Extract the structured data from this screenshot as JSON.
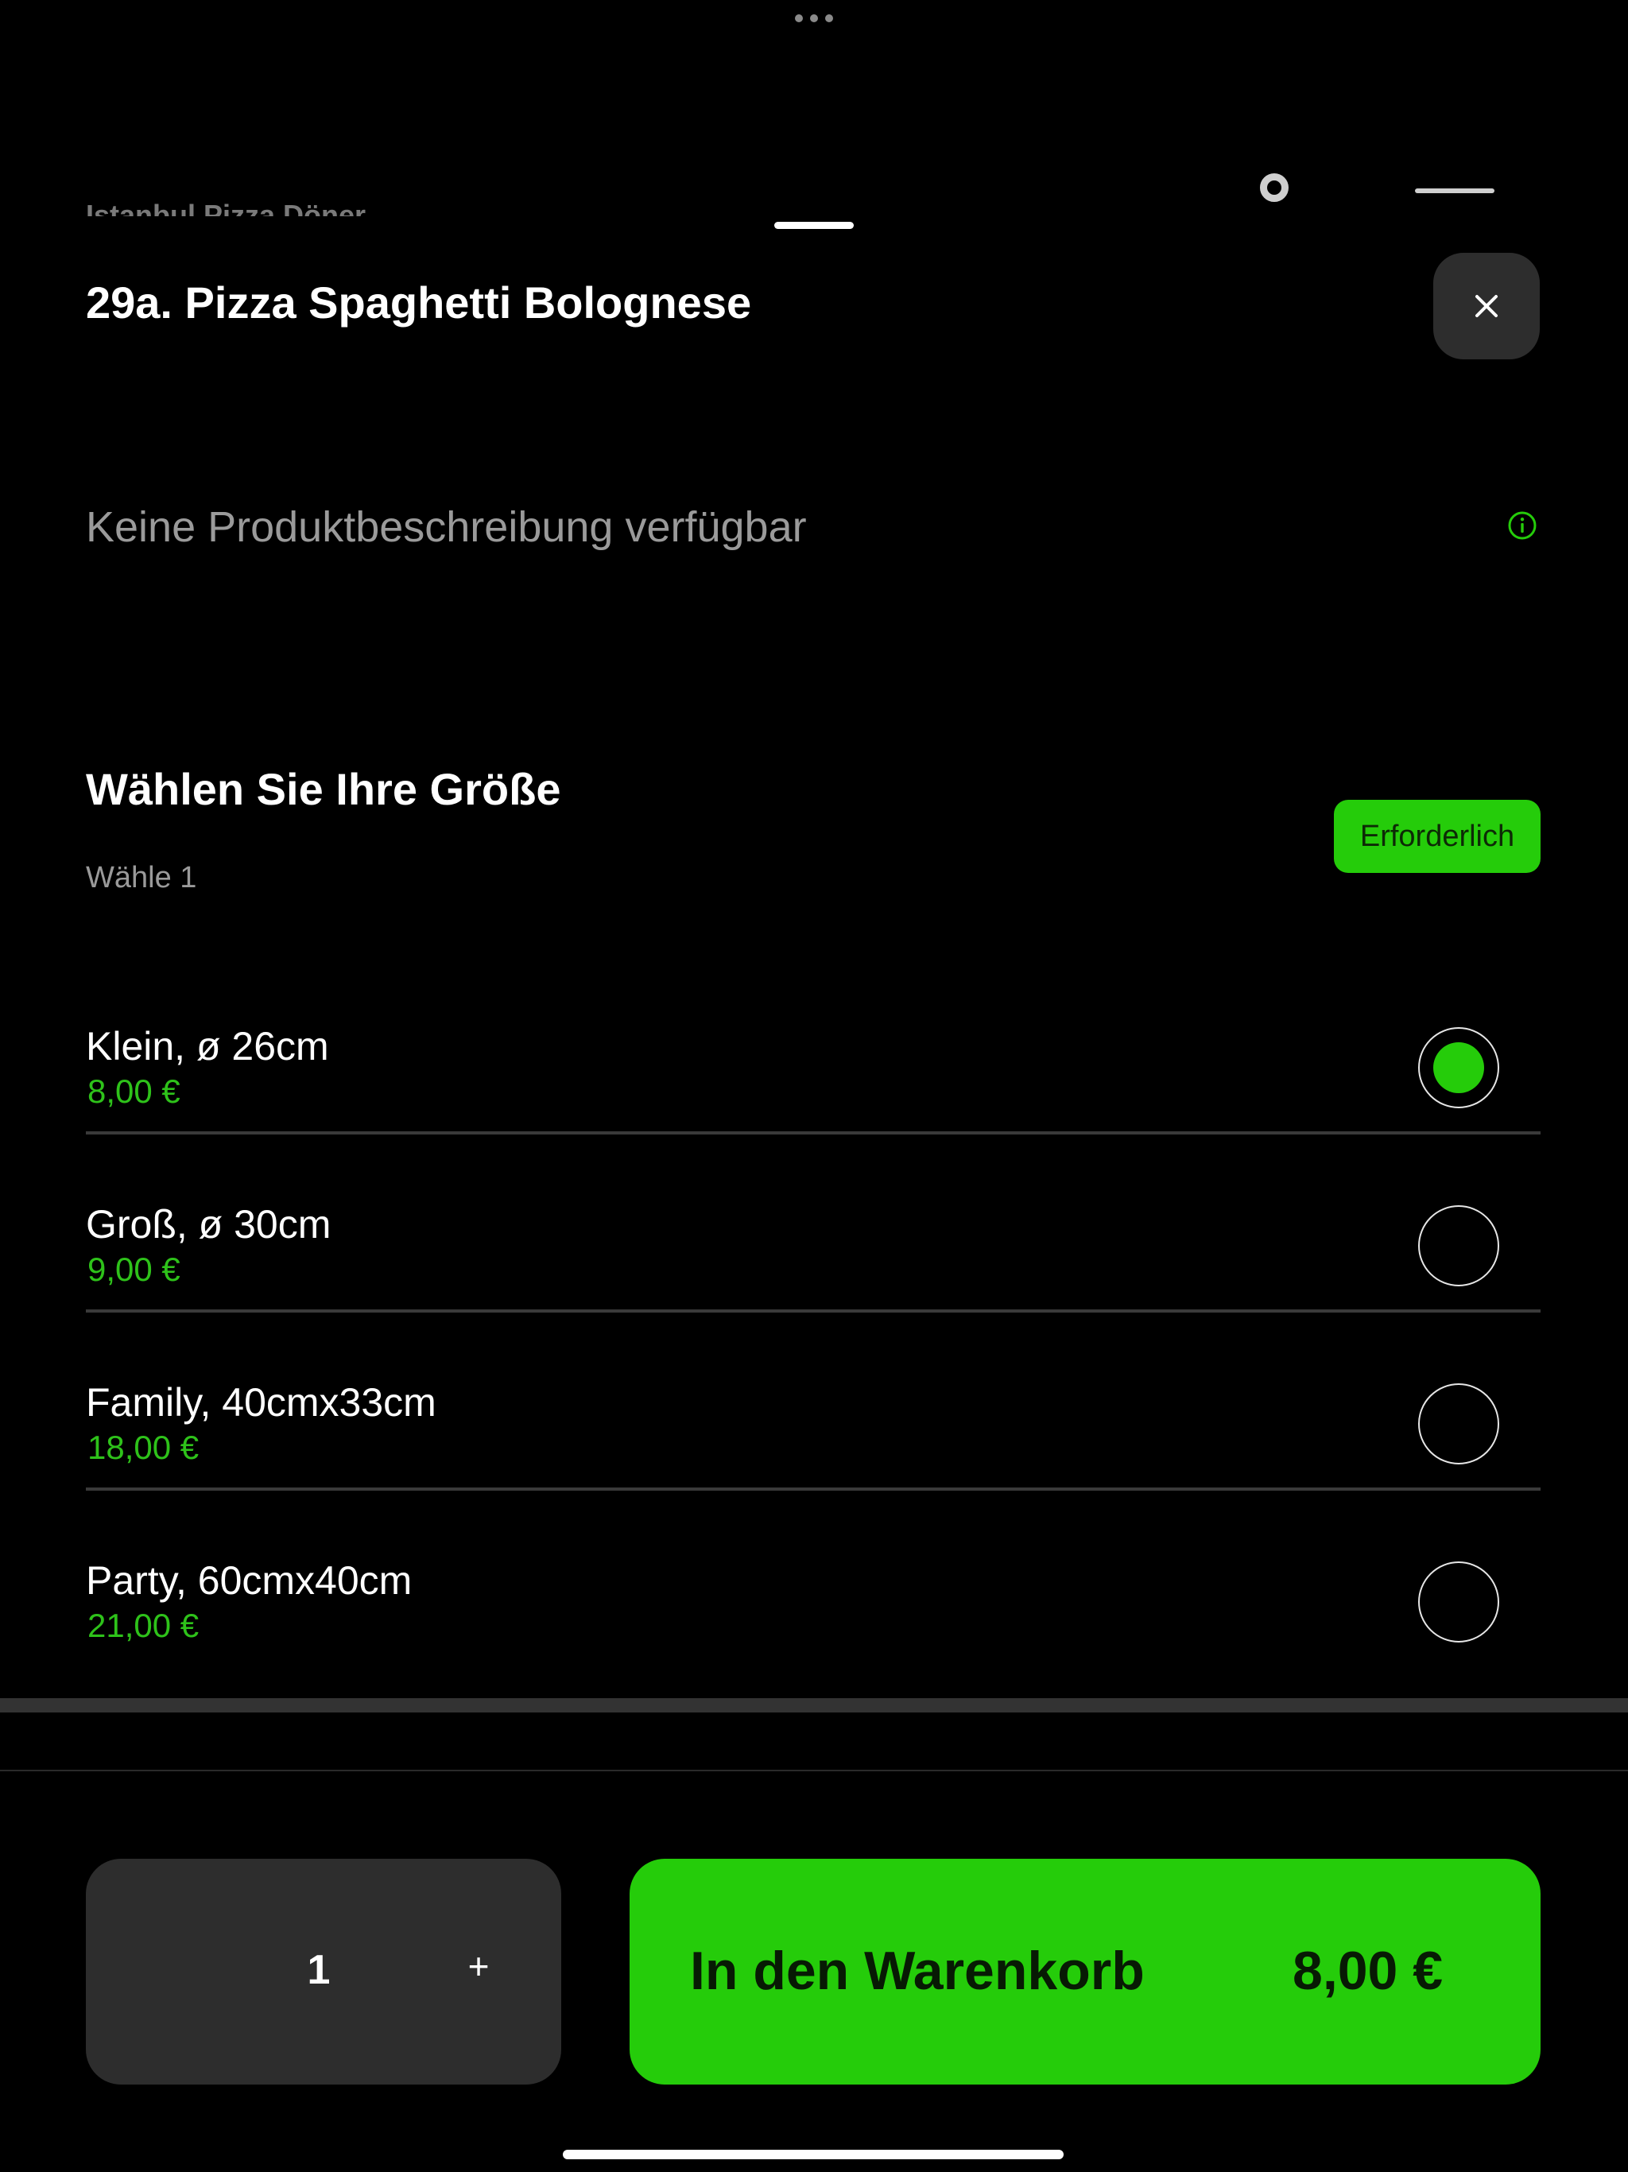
{
  "background_app": {
    "restaurant_name": "Istanbul Pizza Döner",
    "icons": [
      "ring-icon",
      "hamburger-menu-icon"
    ]
  },
  "product": {
    "title": "29a. Pizza Spaghetti Bolognese",
    "description": "Keine Produktbeschreibung verfügbar"
  },
  "size_section": {
    "title": "Wählen Sie Ihre Größe",
    "subtitle": "Wähle 1",
    "badge": "Erforderlich",
    "options": [
      {
        "name": "Klein, ø 26cm",
        "price": "8,00 €",
        "selected": true
      },
      {
        "name": "Groß, ø 30cm",
        "price": "9,00 €",
        "selected": false
      },
      {
        "name": "Family, 40cmx33cm",
        "price": "18,00 €",
        "selected": false
      },
      {
        "name": "Party, 60cmx40cm",
        "price": "21,00 €",
        "selected": false
      }
    ]
  },
  "footer": {
    "quantity": "1",
    "plus_label": "+",
    "add_label": "In den Warenkorb",
    "add_price": "8,00 €"
  },
  "colors": {
    "accent": "#25cc0a",
    "price": "#2ec21a",
    "background": "#000000",
    "surface": "#2d2d2d"
  }
}
